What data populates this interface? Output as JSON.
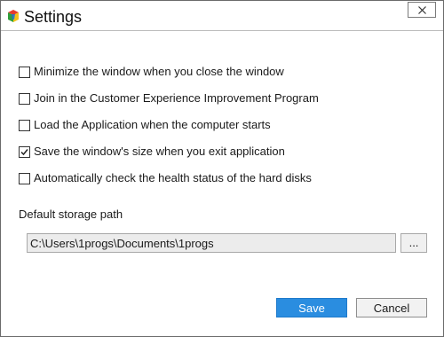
{
  "window": {
    "title": "Settings",
    "app_icon": "app-logo-icon",
    "close_icon": "close-icon"
  },
  "options": [
    {
      "label": "Minimize the window when you close the window",
      "checked": false
    },
    {
      "label": "Join in the Customer Experience Improvement Program",
      "checked": false
    },
    {
      "label": "Load the Application when the computer starts",
      "checked": false
    },
    {
      "label": "Save the window's size when you exit application",
      "checked": true
    },
    {
      "label": "Automatically check the health status of the hard disks",
      "checked": false
    }
  ],
  "storage": {
    "label": "Default storage path",
    "path_value": "C:\\Users\\1progs\\Documents\\1progs",
    "browse_label": "..."
  },
  "buttons": {
    "save_label": "Save",
    "cancel_label": "Cancel"
  },
  "colors": {
    "save_button_bg": "#2a8de0",
    "save_button_text": "#ffffff"
  }
}
